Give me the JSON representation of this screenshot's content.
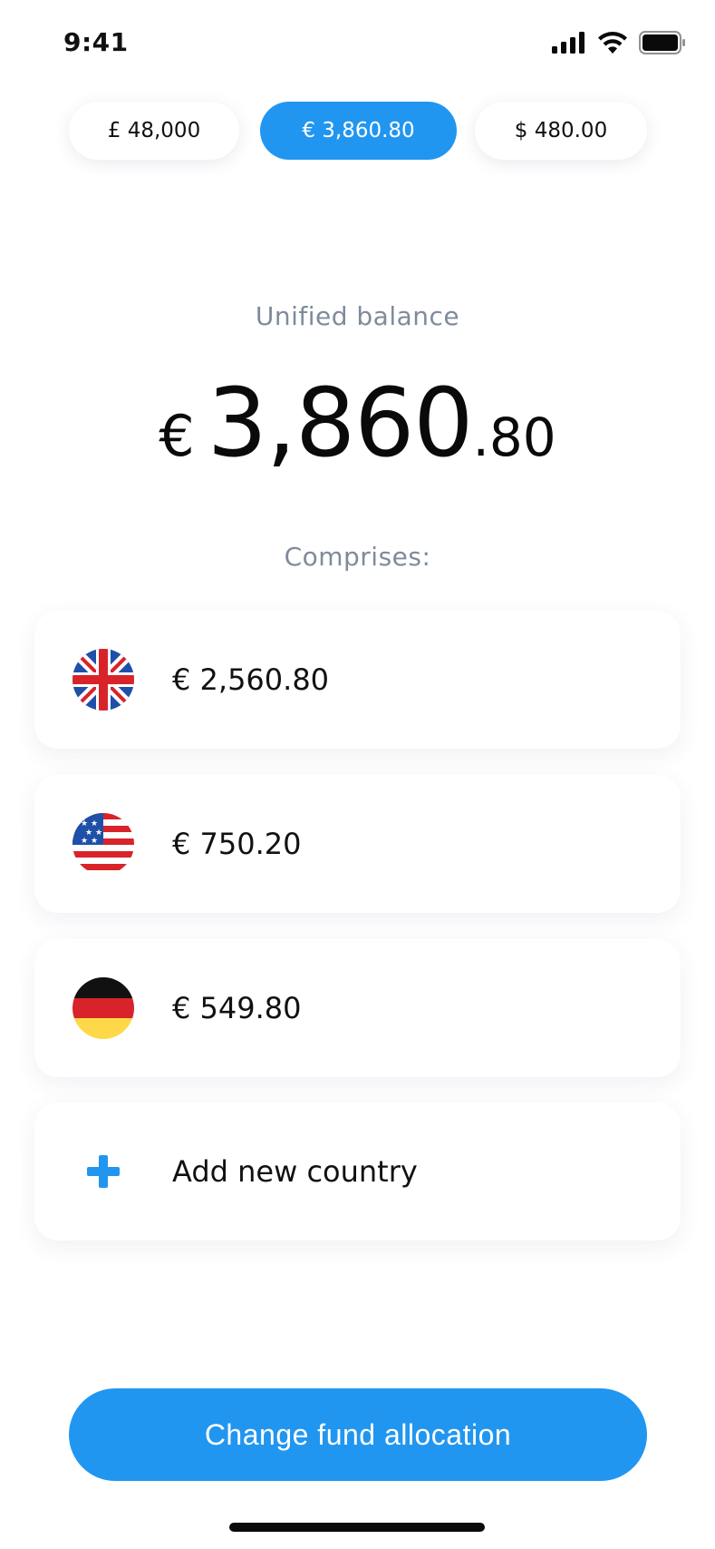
{
  "status_bar": {
    "time": "9:41"
  },
  "currency_tabs": [
    {
      "label": "£ 48,000",
      "active": false
    },
    {
      "label": "€ 3,860.80",
      "active": true
    },
    {
      "label": "$ 480.00",
      "active": false
    }
  ],
  "balance": {
    "label": "Unified balance",
    "currency": "€",
    "whole": "3,860",
    "fraction": ".80"
  },
  "comprises_label": "Comprises:",
  "breakdown": [
    {
      "flag": "uk-flag-icon",
      "amount": "€ 2,560.80"
    },
    {
      "flag": "us-flag-icon",
      "amount": "€ 750.20"
    },
    {
      "flag": "germany-flag-icon",
      "amount": "€ 549.80"
    }
  ],
  "add_country_label": "Add new country",
  "cta_label": "Change fund allocation",
  "colors": {
    "accent": "#2196f0",
    "muted_text": "#7f8b9c",
    "text": "#111111",
    "background": "#ffffff"
  }
}
